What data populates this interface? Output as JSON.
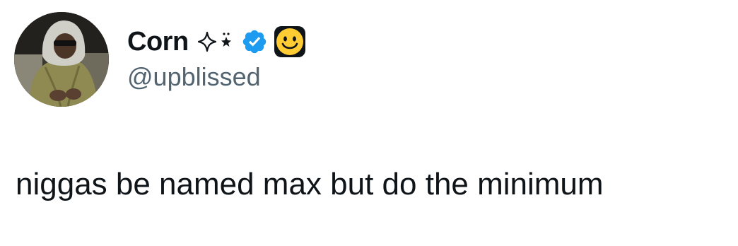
{
  "author": {
    "display_name": "Corn",
    "name_decoration": "sparkle-and-stars-icon",
    "verified_badge": "verified-badge-icon",
    "emoji": "smiling-face-emoji",
    "handle": "@upblissed",
    "avatar": "profile-photo"
  },
  "tweet": {
    "text": "niggas be named max but do the minimum"
  },
  "colors": {
    "text_primary": "#0f1419",
    "text_secondary": "#536471",
    "verified_blue": "#1d9bf0",
    "emoji_yellow": "#ffcc33"
  }
}
